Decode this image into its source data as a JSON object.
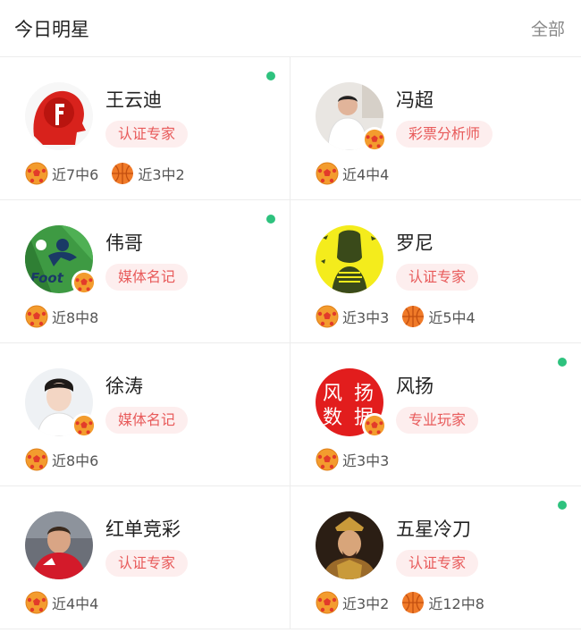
{
  "header": {
    "title": "今日明星",
    "more": "全部"
  },
  "experts": [
    {
      "name": "王云迪",
      "tag": "认证专家",
      "online": true,
      "records": [
        {
          "sport": "football",
          "text": "近7中6"
        },
        {
          "sport": "basketball",
          "text": "近3中2"
        }
      ]
    },
    {
      "name": "冯超",
      "tag": "彩票分析师",
      "online": false,
      "records": [
        {
          "sport": "football",
          "text": "近4中4"
        }
      ]
    },
    {
      "name": "伟哥",
      "tag": "媒体名记",
      "online": true,
      "records": [
        {
          "sport": "football",
          "text": "近8中8"
        }
      ]
    },
    {
      "name": "罗尼",
      "tag": "认证专家",
      "online": false,
      "records": [
        {
          "sport": "football",
          "text": "近3中3"
        },
        {
          "sport": "basketball",
          "text": "近5中4"
        }
      ]
    },
    {
      "name": "徐涛",
      "tag": "媒体名记",
      "online": false,
      "records": [
        {
          "sport": "football",
          "text": "近8中6"
        }
      ]
    },
    {
      "name": "风扬",
      "tag": "专业玩家",
      "online": true,
      "avatar_text": [
        "风",
        "扬",
        "数",
        "据"
      ],
      "records": [
        {
          "sport": "football",
          "text": "近3中3"
        }
      ]
    },
    {
      "name": "红单竞彩",
      "tag": "认证专家",
      "online": false,
      "records": [
        {
          "sport": "football",
          "text": "近4中4"
        }
      ]
    },
    {
      "name": "五星冷刀",
      "tag": "认证专家",
      "online": true,
      "records": [
        {
          "sport": "football",
          "text": "近3中2"
        },
        {
          "sport": "basketball",
          "text": "近12中8"
        }
      ]
    }
  ],
  "colors": {
    "online": "#2ec27e",
    "tag_bg": "#fdeeee",
    "tag_text": "#e85a5a",
    "ball": "#f39c2e"
  }
}
